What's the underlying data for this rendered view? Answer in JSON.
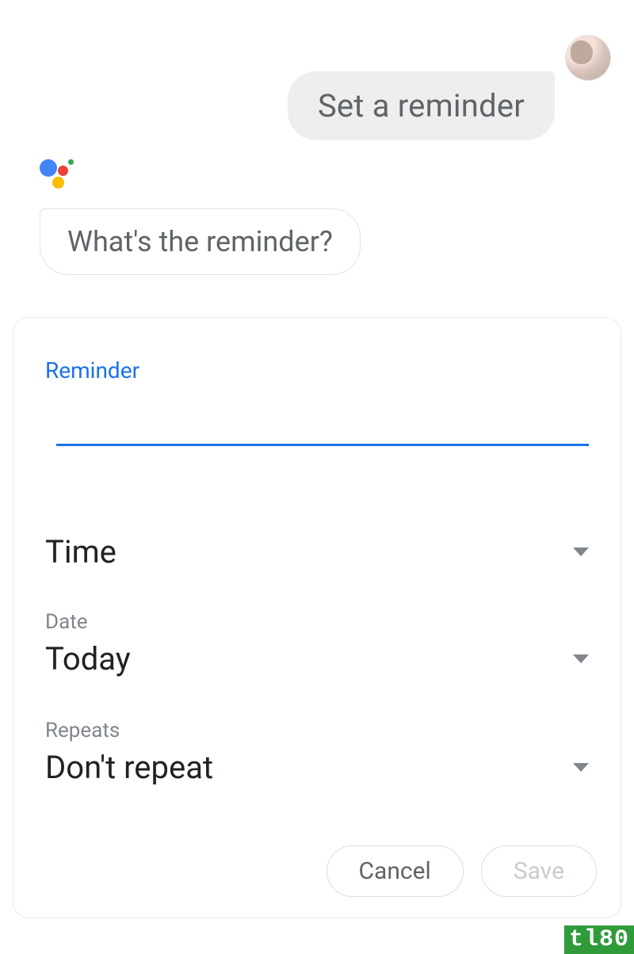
{
  "chat": {
    "user_message": "Set a reminder",
    "assistant_message": "What's the reminder?"
  },
  "card": {
    "input_label": "Reminder",
    "input_value": "",
    "time": {
      "label": "Time",
      "value": "Time"
    },
    "date": {
      "label": "Date",
      "value": "Today"
    },
    "repeats": {
      "label": "Repeats",
      "value": "Don't repeat"
    },
    "buttons": {
      "cancel": "Cancel",
      "save": "Save"
    }
  },
  "watermark": "tl80"
}
